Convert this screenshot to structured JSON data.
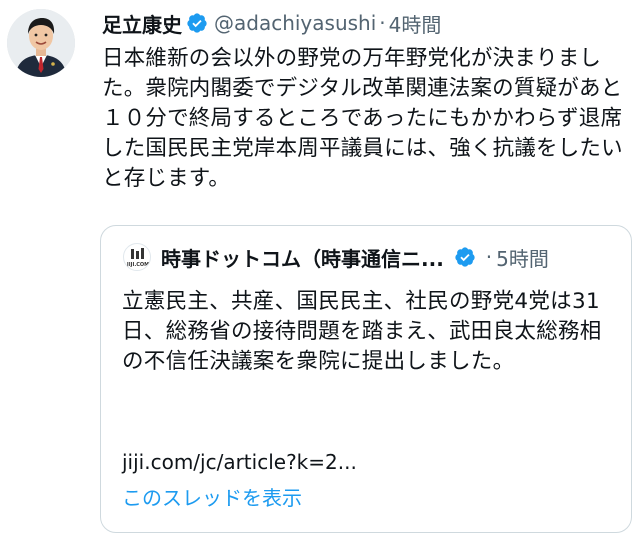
{
  "tweet": {
    "author": {
      "display_name": "足立康史",
      "handle": "@adachiyasushi",
      "verified": true,
      "avatar_icon": "person-in-suit-avatar"
    },
    "separator": "·",
    "time": "4時間",
    "text": "日本維新の会以外の野党の万年野党化が決まりました。衆院内閣委でデジタル改革関連法案の質疑があと１０分で終局するところであったにもかかわらず退席した国民民主党岸本周平議員には、強く抗議をしたいと存じます。"
  },
  "quoted_tweet": {
    "author": {
      "display_name": "時事ドットコム（時事通信ニ...",
      "verified": true,
      "avatar_text": "JIJI.COM"
    },
    "separator": "·",
    "time": "5時間",
    "text": "立憲民主、共産、国民民主、社民の野党4党は31日、総務省の接待問題を踏まえ、武田良太総務相の不信任決議案を衆院に提出しました。",
    "link": "jiji.com/jc/article?k=2...",
    "show_thread": "このスレッドを表示"
  },
  "colors": {
    "text": "#0f1419",
    "secondary": "#536471",
    "accent": "#1d9bf0",
    "border": "#cfd9de"
  }
}
